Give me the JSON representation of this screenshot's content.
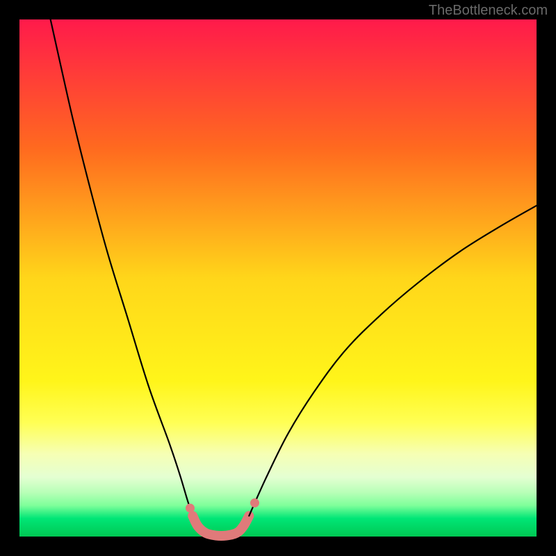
{
  "attribution": "TheBottleneck.com",
  "chart_data": {
    "type": "line",
    "title": "",
    "xlabel": "",
    "ylabel": "",
    "xlim": [
      0,
      100
    ],
    "ylim": [
      0,
      100
    ],
    "grid": false,
    "legend": false,
    "gradient_stops": [
      {
        "offset": 0.0,
        "color": "#ff1a4b"
      },
      {
        "offset": 0.25,
        "color": "#ff6a1f"
      },
      {
        "offset": 0.5,
        "color": "#ffd61a"
      },
      {
        "offset": 0.7,
        "color": "#fff51a"
      },
      {
        "offset": 0.78,
        "color": "#ffff55"
      },
      {
        "offset": 0.84,
        "color": "#f6ffb4"
      },
      {
        "offset": 0.885,
        "color": "#e4ffd2"
      },
      {
        "offset": 0.915,
        "color": "#b7ffb7"
      },
      {
        "offset": 0.94,
        "color": "#7eff9a"
      },
      {
        "offset": 0.965,
        "color": "#00e676"
      },
      {
        "offset": 1.0,
        "color": "#00c853"
      }
    ],
    "series": [
      {
        "name": "left",
        "points": [
          {
            "x": 6.0,
            "y": 100.0
          },
          {
            "x": 8.0,
            "y": 91.0
          },
          {
            "x": 10.5,
            "y": 80.0
          },
          {
            "x": 13.5,
            "y": 68.0
          },
          {
            "x": 17.0,
            "y": 55.0
          },
          {
            "x": 21.0,
            "y": 42.0
          },
          {
            "x": 25.0,
            "y": 29.0
          },
          {
            "x": 29.0,
            "y": 18.0
          },
          {
            "x": 31.0,
            "y": 12.0
          },
          {
            "x": 32.5,
            "y": 7.0
          },
          {
            "x": 33.5,
            "y": 4.0
          }
        ]
      },
      {
        "name": "valley-pink",
        "color": "#e07a7a",
        "lineWidth": 14,
        "points": [
          {
            "x": 33.5,
            "y": 4.0
          },
          {
            "x": 34.5,
            "y": 2.0
          },
          {
            "x": 36.0,
            "y": 0.7
          },
          {
            "x": 38.0,
            "y": 0.2
          },
          {
            "x": 40.0,
            "y": 0.2
          },
          {
            "x": 42.0,
            "y": 0.7
          },
          {
            "x": 43.3,
            "y": 2.0
          },
          {
            "x": 44.4,
            "y": 4.0
          }
        ]
      },
      {
        "name": "right",
        "points": [
          {
            "x": 44.4,
            "y": 4.0
          },
          {
            "x": 45.5,
            "y": 6.5
          },
          {
            "x": 48.0,
            "y": 12.0
          },
          {
            "x": 52.0,
            "y": 20.0
          },
          {
            "x": 57.0,
            "y": 28.0
          },
          {
            "x": 63.0,
            "y": 36.0
          },
          {
            "x": 70.0,
            "y": 43.0
          },
          {
            "x": 77.0,
            "y": 49.0
          },
          {
            "x": 85.0,
            "y": 55.0
          },
          {
            "x": 93.0,
            "y": 60.0
          },
          {
            "x": 100.0,
            "y": 64.0
          }
        ]
      }
    ],
    "markers": [
      {
        "x": 33.0,
        "y": 5.5,
        "r": 6.5,
        "color": "#e07a7a"
      },
      {
        "x": 34.0,
        "y": 3.0,
        "r": 6.5,
        "color": "#e07a7a"
      },
      {
        "x": 45.5,
        "y": 6.5,
        "r": 6.5,
        "color": "#e07a7a"
      }
    ],
    "frame": {
      "outer_border_width": 26,
      "inner_x": 28,
      "inner_y": 28,
      "inner_w": 744,
      "inner_h": 744
    }
  }
}
